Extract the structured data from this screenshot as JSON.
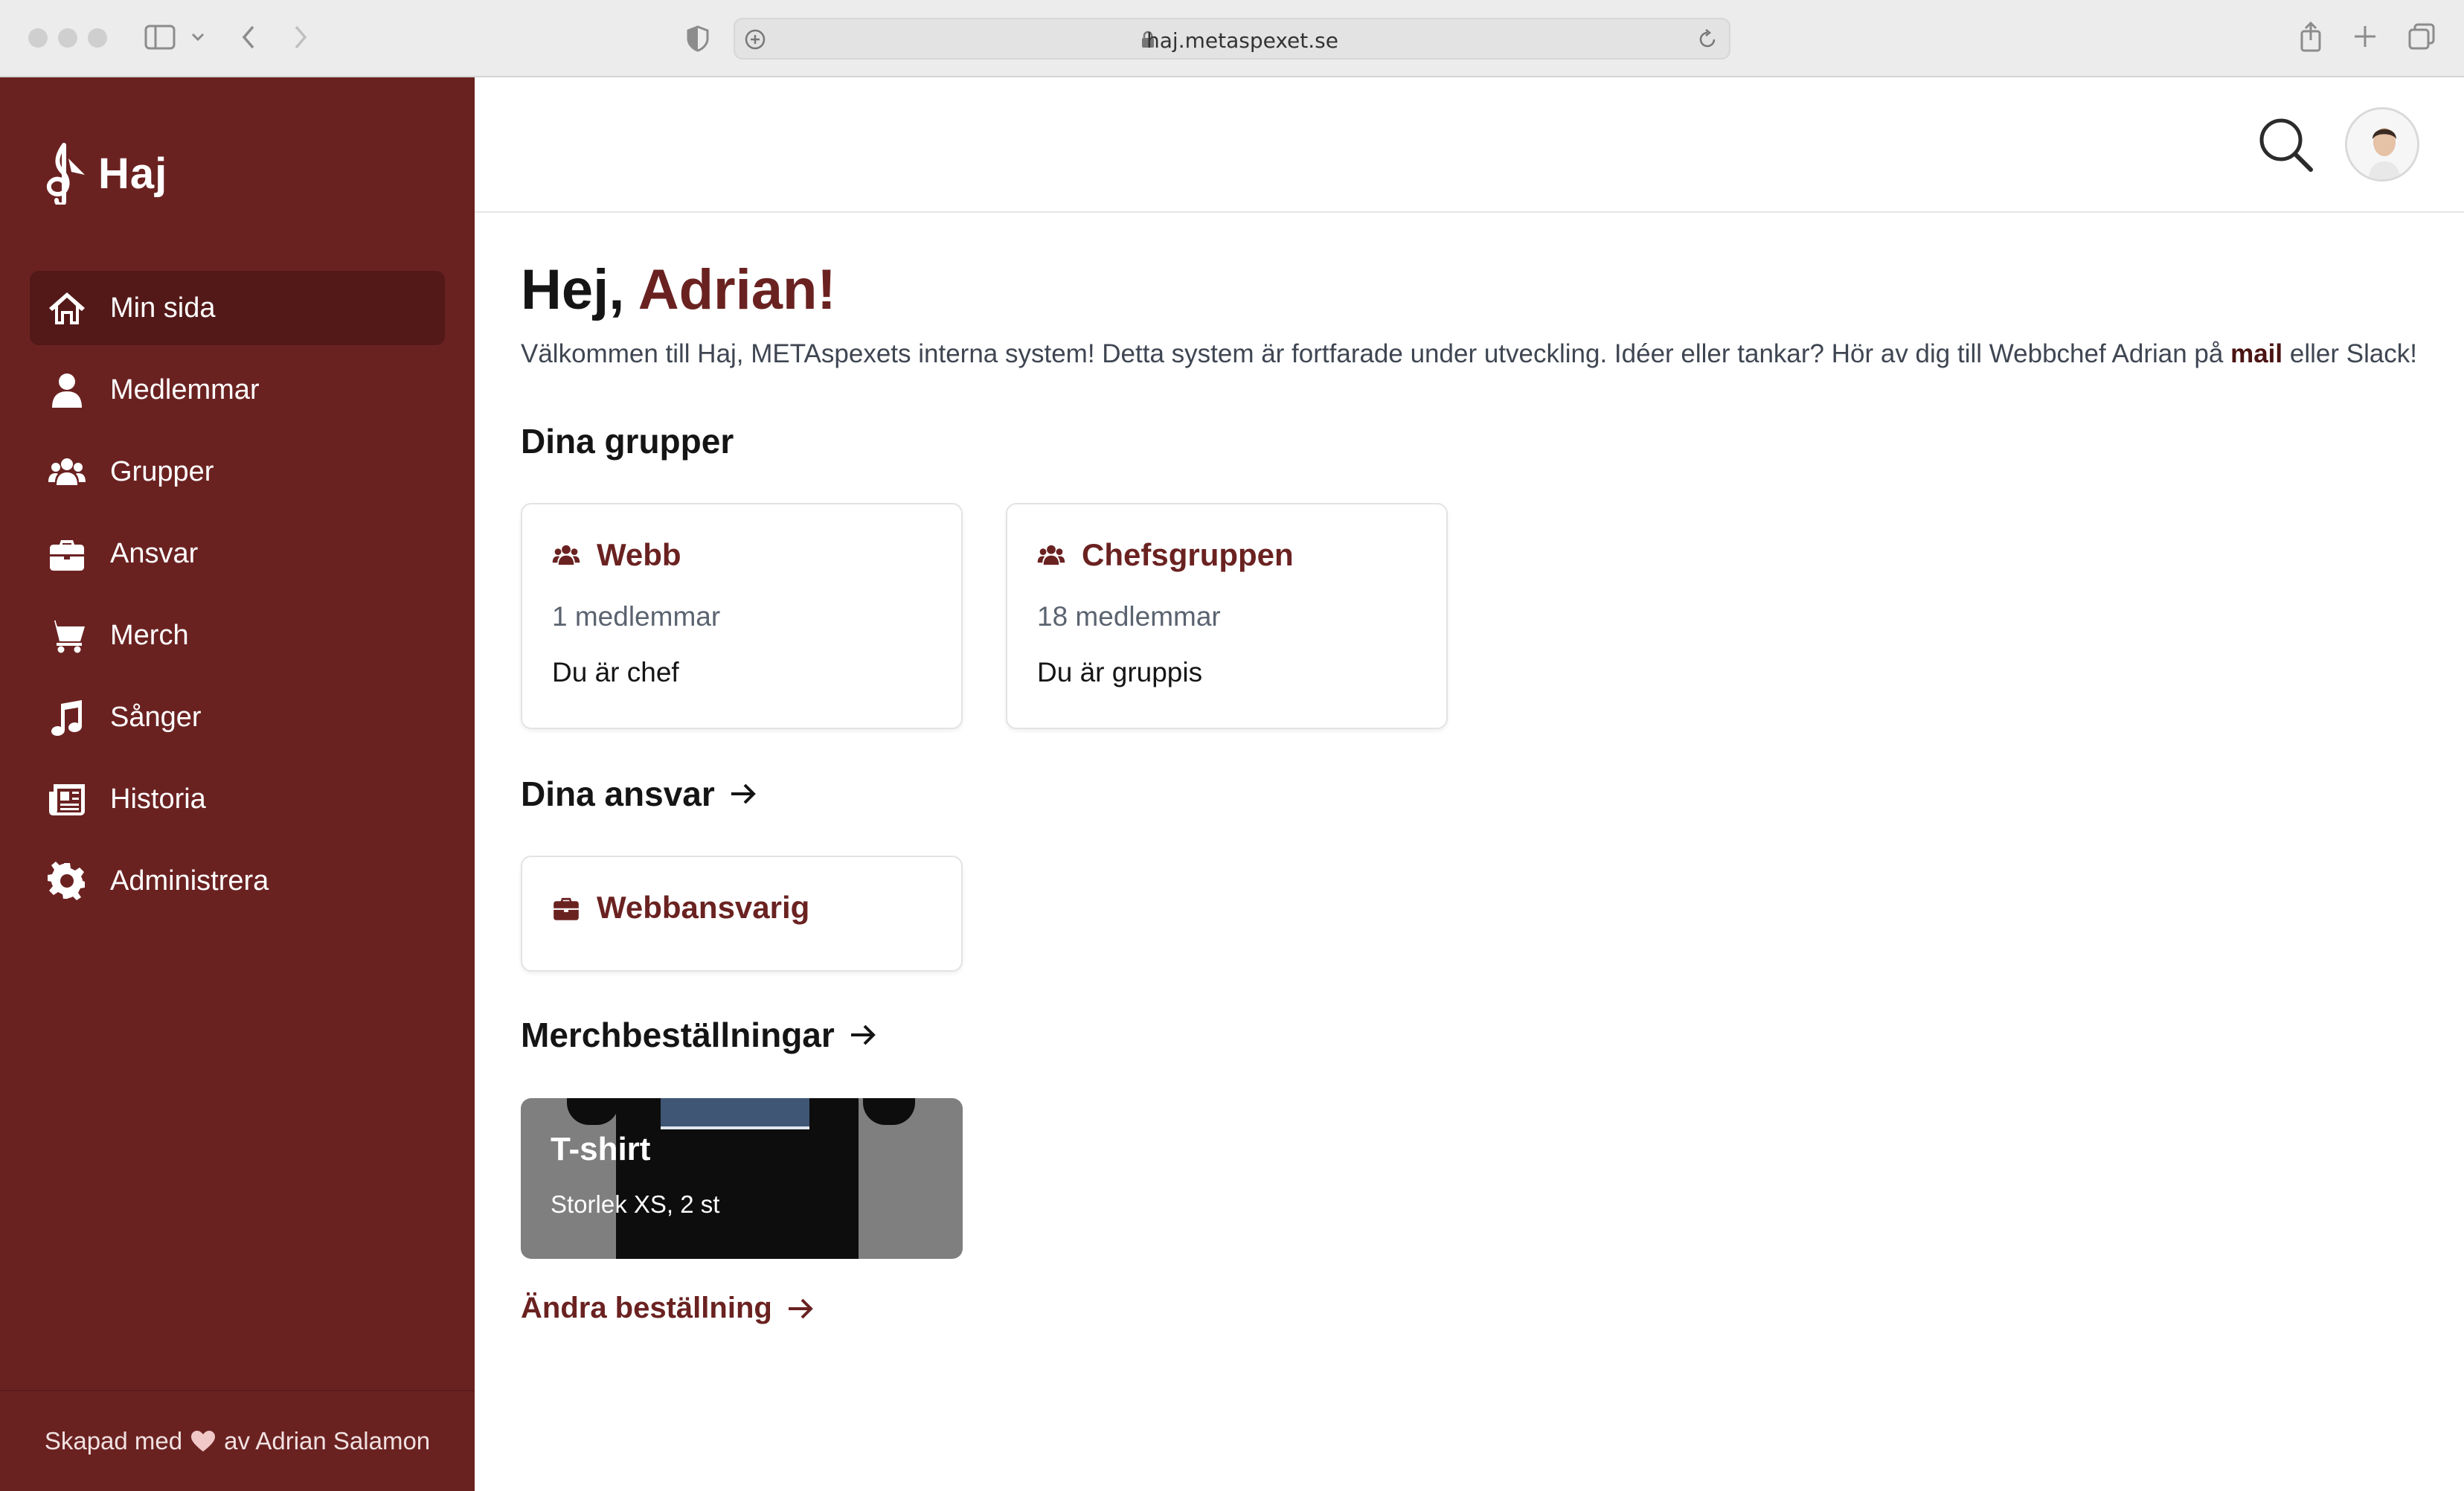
{
  "browser": {
    "url": "haj.metaspexet.se"
  },
  "sidebar": {
    "logo_text": "Haj",
    "items": [
      {
        "label": "Min sida",
        "icon": "home-icon",
        "active": true
      },
      {
        "label": "Medlemmar",
        "icon": "person-icon"
      },
      {
        "label": "Grupper",
        "icon": "group-icon"
      },
      {
        "label": "Ansvar",
        "icon": "briefcase-icon"
      },
      {
        "label": "Merch",
        "icon": "cart-icon"
      },
      {
        "label": "Sånger",
        "icon": "music-note-icon"
      },
      {
        "label": "Historia",
        "icon": "newspaper-icon"
      },
      {
        "label": "Administrera",
        "icon": "gear-icon"
      }
    ],
    "footer": {
      "prefix": "Skapad med",
      "suffix": "av Adrian Salamon"
    }
  },
  "main": {
    "greeting_prefix": "Hej,",
    "greeting_name": "Adrian!",
    "intro_text": "Välkommen till Haj, METAspexets interna system! Detta system är fortfarade under utveckling. Idéer eller tankar? Hör av dig till Webbchef Adrian på",
    "intro_link": "mail",
    "intro_suffix": "eller Slack!",
    "groups_title": "Dina grupper",
    "groups": [
      {
        "name": "Webb",
        "members": "1 medlemmar",
        "role": "Du är chef"
      },
      {
        "name": "Chefsgruppen",
        "members": "18 medlemmar",
        "role": "Du är gruppis"
      }
    ],
    "responsibilities_title": "Dina ansvar",
    "responsibilities": [
      {
        "name": "Webbansvarig"
      }
    ],
    "merch_title": "Merchbeställningar",
    "merch_items": [
      {
        "name": "T-shirt",
        "details": "Storlek XS, 2 st"
      }
    ],
    "change_order_label": "Ändra beställning"
  },
  "colors": {
    "brand": "#6a2221",
    "brand_dark": "#531918"
  }
}
